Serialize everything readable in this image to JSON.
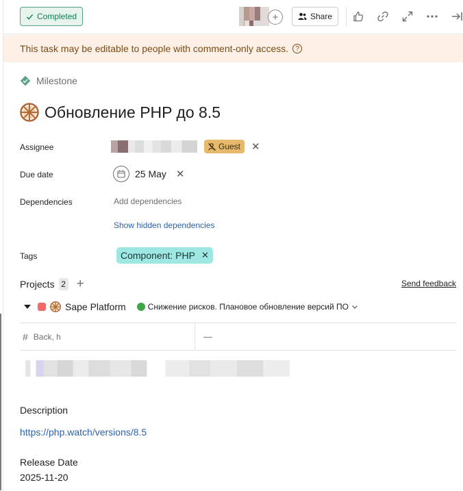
{
  "toolbar": {
    "completed_label": "Completed",
    "share_label": "Share"
  },
  "banner": {
    "text": "This task may be editable to people with comment-only access.",
    "help": "?"
  },
  "task": {
    "type_label": "Milestone",
    "title": "Обновление PHP до 8.5"
  },
  "fields": {
    "assignee": {
      "label": "Assignee",
      "guest_badge": "Guest"
    },
    "due_date": {
      "label": "Due date",
      "value": "25 May"
    },
    "dependencies": {
      "label": "Dependencies",
      "add": "Add dependencies",
      "show_hidden": "Show hidden dependencies"
    },
    "tags": {
      "label": "Tags",
      "items": [
        "Component: PHP"
      ]
    }
  },
  "projects": {
    "label": "Projects",
    "count": "2",
    "feedback": "Send feedback",
    "items": [
      {
        "name": "Sape Platform",
        "section": "Снижение рисков. Плановое обновление версий ПО",
        "color": "#f06a6a"
      }
    ],
    "custom_field": {
      "name": "Back, h",
      "value": "—"
    }
  },
  "description": {
    "label": "Description",
    "link": "https://php.watch/versions/8.5"
  },
  "release": {
    "label": "Release Date",
    "value": "2025-11-20"
  },
  "colors": {
    "completed_green": "#0d7f56",
    "banner_bg": "#fdf1e7",
    "tag_bg": "#9ee7e3",
    "guest_bg": "#e7b96b",
    "link_blue": "#2d61a8"
  }
}
